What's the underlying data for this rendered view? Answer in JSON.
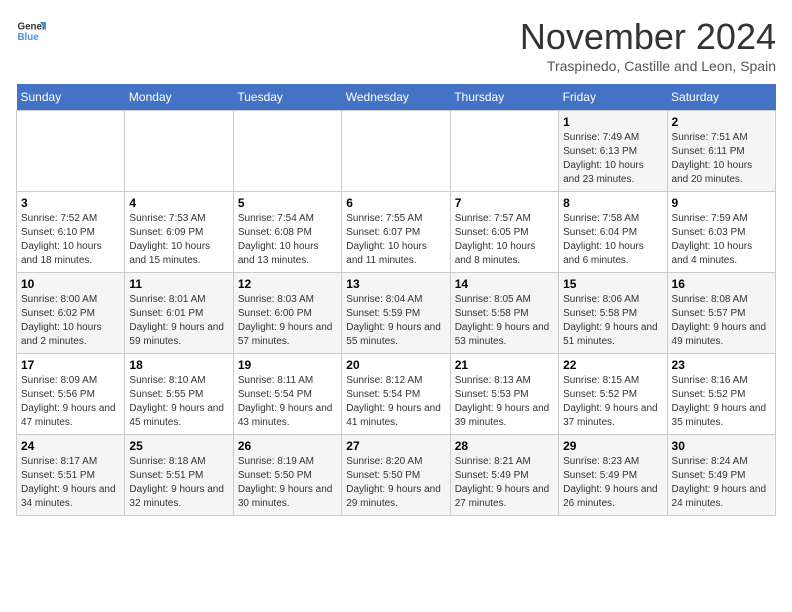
{
  "header": {
    "logo_line1": "General",
    "logo_line2": "Blue",
    "month": "November 2024",
    "location": "Traspinedo, Castille and Leon, Spain"
  },
  "weekdays": [
    "Sunday",
    "Monday",
    "Tuesday",
    "Wednesday",
    "Thursday",
    "Friday",
    "Saturday"
  ],
  "weeks": [
    [
      {
        "day": "",
        "info": ""
      },
      {
        "day": "",
        "info": ""
      },
      {
        "day": "",
        "info": ""
      },
      {
        "day": "",
        "info": ""
      },
      {
        "day": "",
        "info": ""
      },
      {
        "day": "1",
        "info": "Sunrise: 7:49 AM\nSunset: 6:13 PM\nDaylight: 10 hours and 23 minutes."
      },
      {
        "day": "2",
        "info": "Sunrise: 7:51 AM\nSunset: 6:11 PM\nDaylight: 10 hours and 20 minutes."
      }
    ],
    [
      {
        "day": "3",
        "info": "Sunrise: 7:52 AM\nSunset: 6:10 PM\nDaylight: 10 hours and 18 minutes."
      },
      {
        "day": "4",
        "info": "Sunrise: 7:53 AM\nSunset: 6:09 PM\nDaylight: 10 hours and 15 minutes."
      },
      {
        "day": "5",
        "info": "Sunrise: 7:54 AM\nSunset: 6:08 PM\nDaylight: 10 hours and 13 minutes."
      },
      {
        "day": "6",
        "info": "Sunrise: 7:55 AM\nSunset: 6:07 PM\nDaylight: 10 hours and 11 minutes."
      },
      {
        "day": "7",
        "info": "Sunrise: 7:57 AM\nSunset: 6:05 PM\nDaylight: 10 hours and 8 minutes."
      },
      {
        "day": "8",
        "info": "Sunrise: 7:58 AM\nSunset: 6:04 PM\nDaylight: 10 hours and 6 minutes."
      },
      {
        "day": "9",
        "info": "Sunrise: 7:59 AM\nSunset: 6:03 PM\nDaylight: 10 hours and 4 minutes."
      }
    ],
    [
      {
        "day": "10",
        "info": "Sunrise: 8:00 AM\nSunset: 6:02 PM\nDaylight: 10 hours and 2 minutes."
      },
      {
        "day": "11",
        "info": "Sunrise: 8:01 AM\nSunset: 6:01 PM\nDaylight: 9 hours and 59 minutes."
      },
      {
        "day": "12",
        "info": "Sunrise: 8:03 AM\nSunset: 6:00 PM\nDaylight: 9 hours and 57 minutes."
      },
      {
        "day": "13",
        "info": "Sunrise: 8:04 AM\nSunset: 5:59 PM\nDaylight: 9 hours and 55 minutes."
      },
      {
        "day": "14",
        "info": "Sunrise: 8:05 AM\nSunset: 5:58 PM\nDaylight: 9 hours and 53 minutes."
      },
      {
        "day": "15",
        "info": "Sunrise: 8:06 AM\nSunset: 5:58 PM\nDaylight: 9 hours and 51 minutes."
      },
      {
        "day": "16",
        "info": "Sunrise: 8:08 AM\nSunset: 5:57 PM\nDaylight: 9 hours and 49 minutes."
      }
    ],
    [
      {
        "day": "17",
        "info": "Sunrise: 8:09 AM\nSunset: 5:56 PM\nDaylight: 9 hours and 47 minutes."
      },
      {
        "day": "18",
        "info": "Sunrise: 8:10 AM\nSunset: 5:55 PM\nDaylight: 9 hours and 45 minutes."
      },
      {
        "day": "19",
        "info": "Sunrise: 8:11 AM\nSunset: 5:54 PM\nDaylight: 9 hours and 43 minutes."
      },
      {
        "day": "20",
        "info": "Sunrise: 8:12 AM\nSunset: 5:54 PM\nDaylight: 9 hours and 41 minutes."
      },
      {
        "day": "21",
        "info": "Sunrise: 8:13 AM\nSunset: 5:53 PM\nDaylight: 9 hours and 39 minutes."
      },
      {
        "day": "22",
        "info": "Sunrise: 8:15 AM\nSunset: 5:52 PM\nDaylight: 9 hours and 37 minutes."
      },
      {
        "day": "23",
        "info": "Sunrise: 8:16 AM\nSunset: 5:52 PM\nDaylight: 9 hours and 35 minutes."
      }
    ],
    [
      {
        "day": "24",
        "info": "Sunrise: 8:17 AM\nSunset: 5:51 PM\nDaylight: 9 hours and 34 minutes."
      },
      {
        "day": "25",
        "info": "Sunrise: 8:18 AM\nSunset: 5:51 PM\nDaylight: 9 hours and 32 minutes."
      },
      {
        "day": "26",
        "info": "Sunrise: 8:19 AM\nSunset: 5:50 PM\nDaylight: 9 hours and 30 minutes."
      },
      {
        "day": "27",
        "info": "Sunrise: 8:20 AM\nSunset: 5:50 PM\nDaylight: 9 hours and 29 minutes."
      },
      {
        "day": "28",
        "info": "Sunrise: 8:21 AM\nSunset: 5:49 PM\nDaylight: 9 hours and 27 minutes."
      },
      {
        "day": "29",
        "info": "Sunrise: 8:23 AM\nSunset: 5:49 PM\nDaylight: 9 hours and 26 minutes."
      },
      {
        "day": "30",
        "info": "Sunrise: 8:24 AM\nSunset: 5:49 PM\nDaylight: 9 hours and 24 minutes."
      }
    ]
  ]
}
